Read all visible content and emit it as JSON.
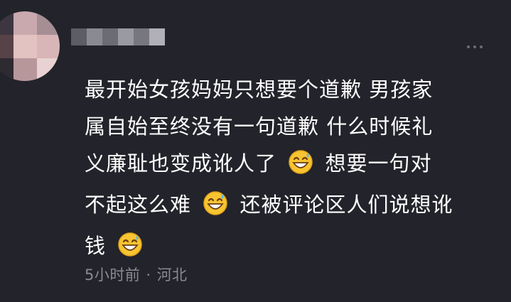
{
  "comment": {
    "body_lines": [
      "最开始女孩妈妈只想要个道歉 男孩家",
      "属自始至终没有一句道歉 什么时候礼",
      "义廉耻也变成讹人了",
      "想要一句对",
      "不起这么难",
      "还被评论区人们说想讹",
      "钱"
    ],
    "emoji": "grinning-face-with-sweat",
    "time": "5小时前",
    "separator": "·",
    "location": "河北"
  },
  "colors": {
    "background": "#23232b",
    "text": "#ffffff",
    "meta": "#8a8a95",
    "emoji_face": "#f7c431"
  }
}
